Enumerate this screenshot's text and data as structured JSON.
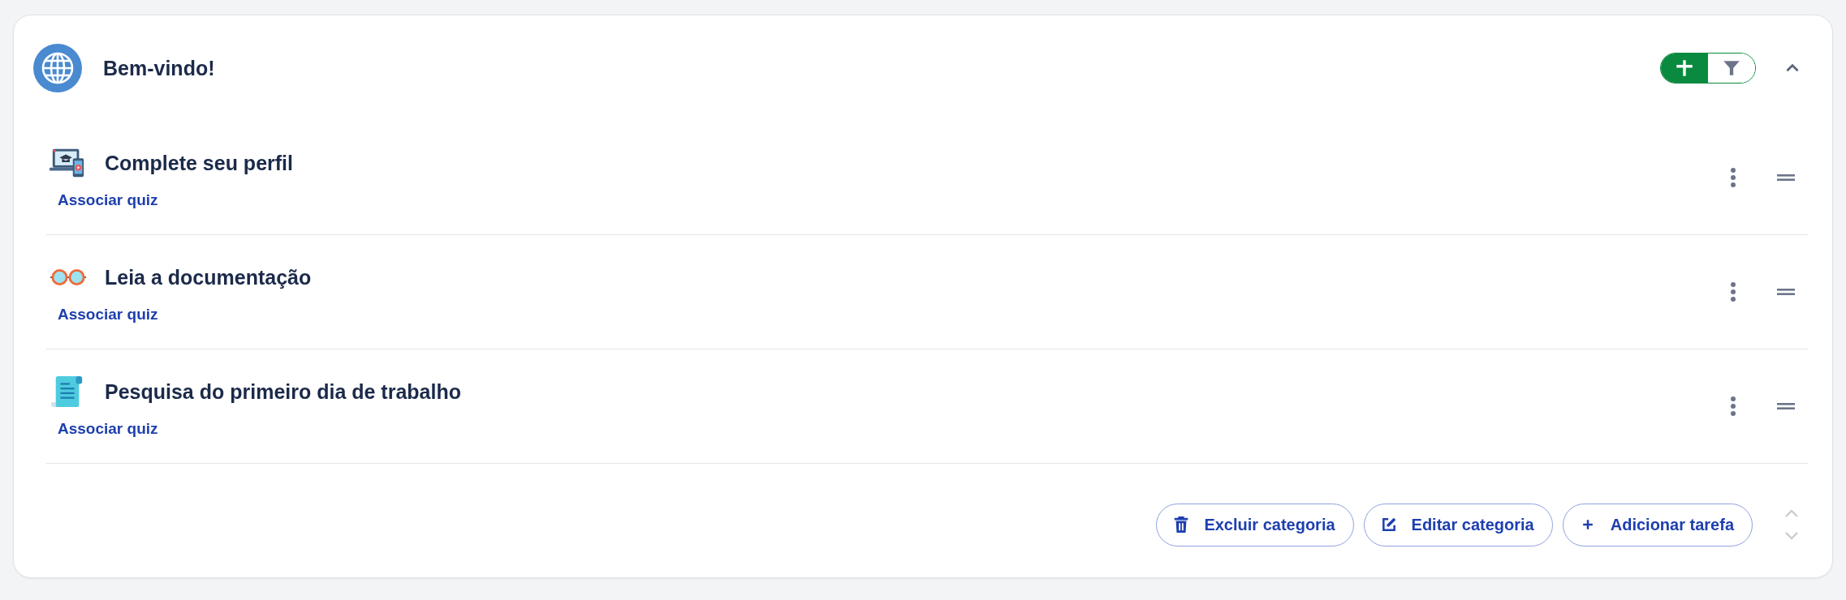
{
  "category": {
    "title": "Bem-vindo!",
    "expanded": true
  },
  "view_toggle": [
    {
      "kind": "add",
      "selected": true
    },
    {
      "kind": "filter",
      "selected": false
    }
  ],
  "tasks": [
    {
      "kind": "laptop",
      "title": "Complete seu perfil",
      "link": "Associar quiz"
    },
    {
      "kind": "glasses",
      "title": "Leia a documentação",
      "link": "Associar quiz"
    },
    {
      "kind": "scroll",
      "title": "Pesquisa do primeiro dia de trabalho",
      "link": "Associar quiz"
    }
  ],
  "actions": [
    {
      "kind": "delete",
      "label": "Excluir categoria"
    },
    {
      "kind": "edit",
      "label": "Editar categoria"
    },
    {
      "kind": "add",
      "label": "Adicionar tarefa"
    }
  ],
  "reorder": {
    "up_disabled": true,
    "down_disabled": true
  }
}
